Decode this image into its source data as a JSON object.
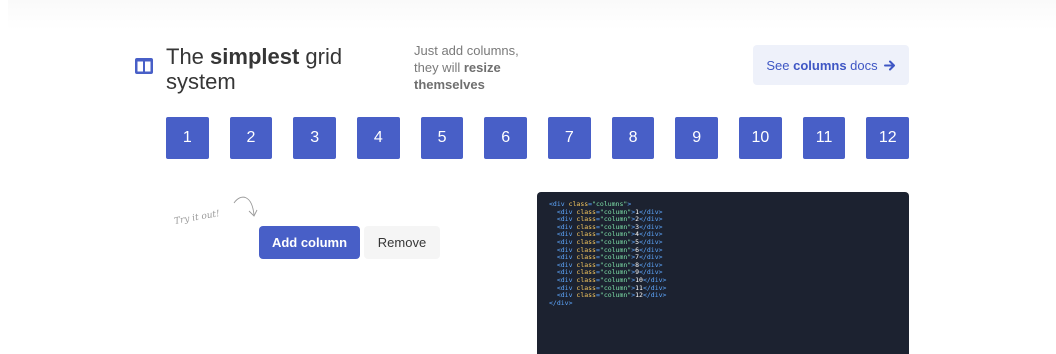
{
  "header": {
    "title_pre": "The ",
    "title_strong": "simplest",
    "title_post": " grid system",
    "subtitle_line1": "Just add columns,",
    "subtitle_pre": "they will ",
    "subtitle_strong1": "resize",
    "subtitle_strong2": "themselves",
    "icon": "columns-icon"
  },
  "docs_button": {
    "pre": "See ",
    "strong": "columns",
    "post": " docs",
    "icon": "arrow-right-icon"
  },
  "columns": [
    "1",
    "2",
    "3",
    "4",
    "5",
    "6",
    "7",
    "8",
    "9",
    "10",
    "11",
    "12"
  ],
  "hint": "Try it out!",
  "actions": {
    "add_label": "Add column",
    "remove_label": "Remove"
  },
  "code": {
    "open": "<div class=\"columns\">",
    "column_prefix": "  <div class=\"column\">",
    "column_suffix": "</div>",
    "close": "</div>"
  },
  "colors": {
    "primary": "#485fc7",
    "light": "#eef1fa",
    "code_bg": "#1c2230"
  }
}
